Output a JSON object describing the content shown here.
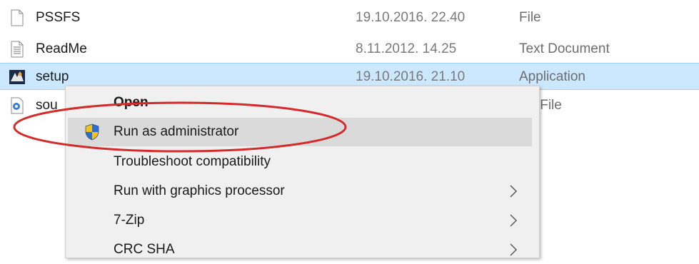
{
  "files": [
    {
      "name": "PSSFS",
      "date": "19.10.2016. 22.40",
      "type": "File",
      "icon": "blank-file-icon"
    },
    {
      "name": "ReadMe",
      "date": "8.11.2012. 14.25",
      "type": "Text Document",
      "icon": "text-document-icon"
    },
    {
      "name": "setup",
      "date": "19.10.2016. 21.10",
      "type": "Application",
      "icon": "application-icon"
    },
    {
      "name": "sou",
      "date": "",
      "type": "AV File",
      "icon": "audio-file-icon"
    }
  ],
  "context_menu": {
    "items": [
      {
        "label": "Open",
        "bold": true
      },
      {
        "label": "Run as administrator",
        "icon": "uac-shield-icon"
      },
      {
        "label": "Troubleshoot compatibility"
      },
      {
        "label": "Run with graphics processor",
        "submenu": true
      },
      {
        "label": "7-Zip",
        "submenu": true
      },
      {
        "label": "CRC SHA",
        "submenu": true
      }
    ]
  },
  "colors": {
    "selection": "#cce8ff",
    "menu_background": "#f0f0f0",
    "menu_hover": "#dadada",
    "annotation": "#d42a2a"
  }
}
